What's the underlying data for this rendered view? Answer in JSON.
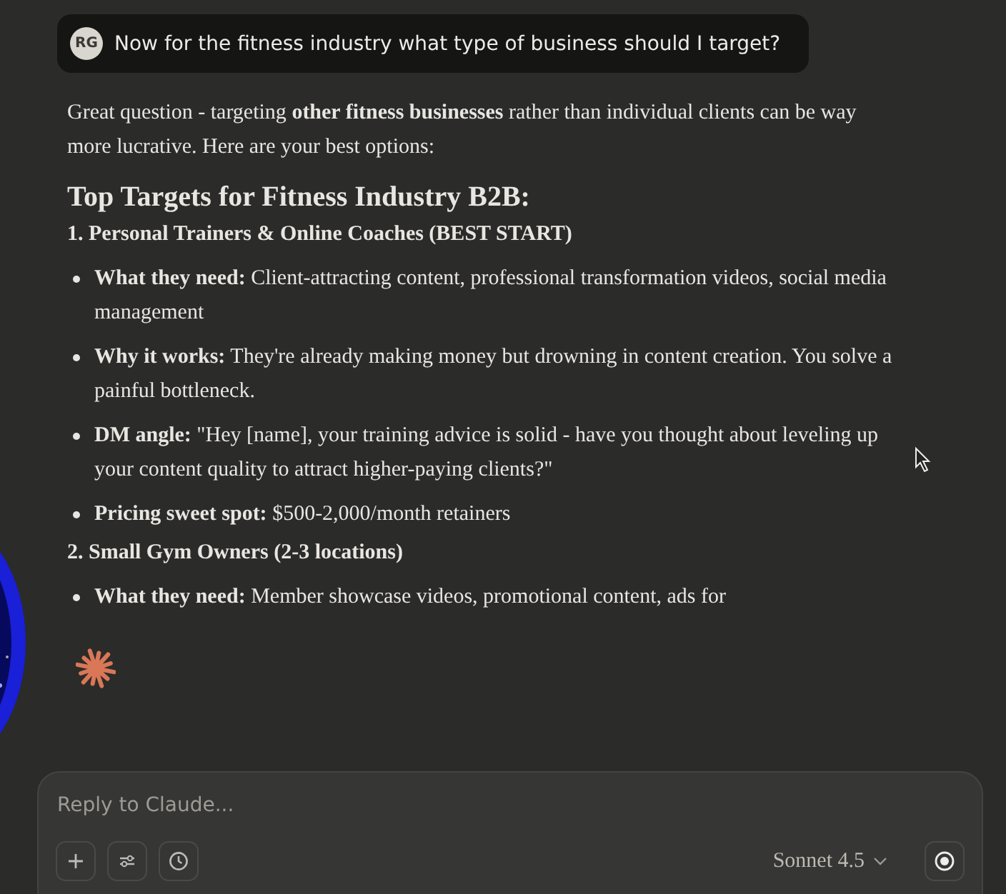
{
  "user_message": {
    "avatar": "RG",
    "text": "Now for the fitness industry what type of business should I target?"
  },
  "response": [
    {
      "kind": "paragraph",
      "text": "Great question - targeting **other fitness businesses** rather than individual clients can be way more lucrative. Here are your best options:"
    },
    {
      "kind": "heading",
      "text": "Top Targets for Fitness Industry B2B:"
    },
    {
      "kind": "subheading",
      "text": "1. Personal Trainers & Online Coaches (BEST START)"
    },
    {
      "kind": "bullet",
      "text": "**What they need:** Client-attracting content, professional transformation videos, social media management"
    },
    {
      "kind": "bullet",
      "text": "**Why it works:** They're already making money but drowning in content creation. You solve a painful bottleneck."
    },
    {
      "kind": "bullet",
      "text": "**DM angle:** \"Hey [name], your training advice is solid - have you thought about leveling up your content quality to attract higher-paying clients?\""
    },
    {
      "kind": "bullet",
      "text": "**Pricing sweet spot:** $500-2,000/month retainers"
    },
    {
      "kind": "subheading",
      "text": "2. Small Gym Owners (2-3 locations)"
    },
    {
      "kind": "bullet",
      "text": "**What they need:** Member showcase videos, promotional content, ads for"
    }
  ],
  "composer": {
    "placeholder": "Reply to Claude...",
    "model": "Sonnet 4.5"
  }
}
